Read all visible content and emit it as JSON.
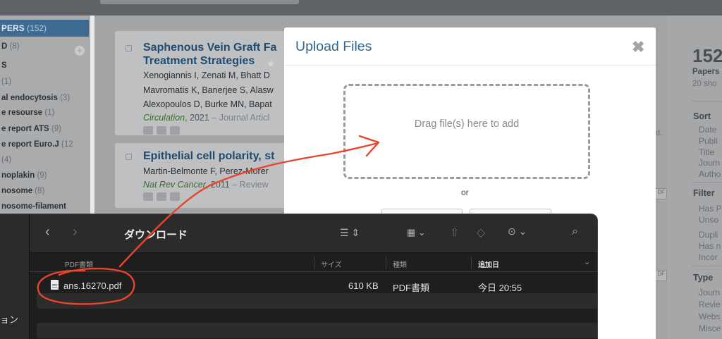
{
  "sidebar": {
    "active": {
      "label": "PERS",
      "count": "(152)"
    },
    "items": [
      {
        "label": "D",
        "count": "(8)"
      },
      {
        "label": "S",
        "count": ""
      },
      {
        "label": "",
        "count": "(1)"
      },
      {
        "label": "al endocytosis",
        "count": "(3)"
      },
      {
        "label": "e resourse",
        "count": "(1)"
      },
      {
        "label": "e report ATS",
        "count": "(9)"
      },
      {
        "label": "e report Euro.J",
        "count": "(12"
      },
      {
        "label": "",
        "count": "(4)"
      },
      {
        "label": "noplakin",
        "count": "(9)"
      },
      {
        "label": "nosome",
        "count": "(8)"
      },
      {
        "label": "nosome-filament",
        "count": ""
      }
    ]
  },
  "papers": [
    {
      "title_line1": "Saphenous Vein Graft Fa",
      "title_line2": "Treatment Strategies",
      "authors": [
        "Xenogiannis I, Zenati M, Bhatt D",
        "Mavromatis K, Banerjee S, Alasw",
        "Alexopoulos D, Burke MN, Bapat"
      ],
      "journal": "Circulation",
      "year_suffix": ", 2021",
      "extra": " – Journal Articl"
    },
    {
      "title_line1": "Epithelial cell polarity, st",
      "title_line2": "",
      "authors": [
        "Martin-Belmonte F, Perez-Morer"
      ],
      "journal": "Nat Rev Cancer",
      "year_suffix": ", 2011",
      "extra": " – Review"
    }
  ],
  "behind_fragments": {
    "d": "d."
  },
  "right_panel": {
    "count": "152",
    "label": "Papers",
    "subtitle": "20 sho",
    "sort_header": "Sort",
    "sort_items": [
      "Date",
      "Publi",
      "Title",
      "Journ",
      "Autho"
    ],
    "filter_header": "Filter",
    "filter_items": [
      "Has P",
      "Unso",
      "Dupli",
      "Has n",
      "Incor"
    ],
    "type_header": "Type",
    "type_items": [
      "Journ",
      "Revie",
      "Webs",
      "Misce"
    ]
  },
  "modal": {
    "title": "Upload Files",
    "close": "✖",
    "dropzone_text": "Drag file(s) here to add",
    "or": "or"
  },
  "finder": {
    "title": "ダウンロード",
    "sidebar_label": "ョン",
    "group_label": "PDF書類",
    "columns": {
      "size": "サイズ",
      "kind": "種類",
      "date": "追加日"
    },
    "files": [
      {
        "name": "ans.16270.pdf",
        "size": "610 KB",
        "kind": "PDF書類",
        "date": "今日 20:55"
      }
    ]
  },
  "colors": {
    "accent": "#2e6690",
    "annotation_red": "#e8452c",
    "finder_bg": "#1e1e1f"
  },
  "icons": [
    "back-icon",
    "forward-icon",
    "list-view-icon",
    "grid-view-icon",
    "share-icon",
    "tag-icon",
    "more-icon",
    "search-icon",
    "close-icon",
    "file-icon"
  ]
}
